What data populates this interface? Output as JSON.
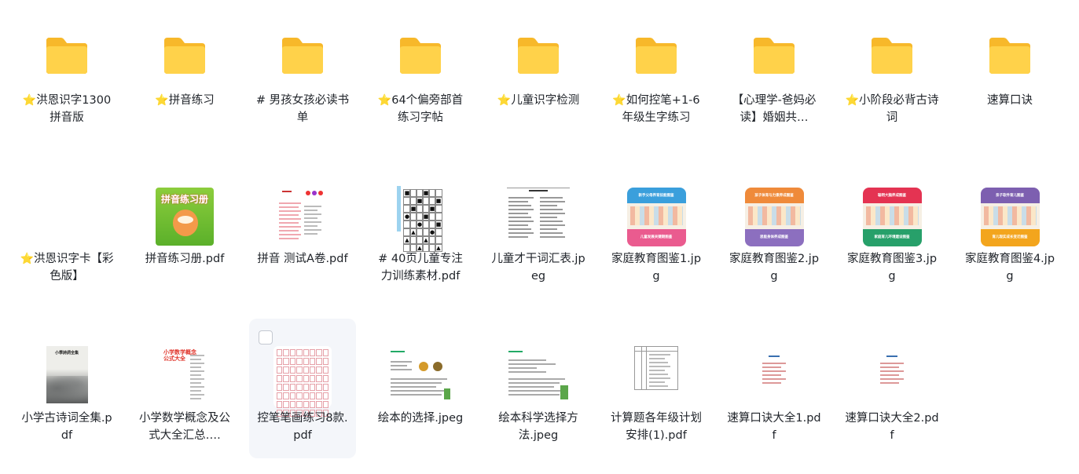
{
  "items": [
    {
      "name": "洪恩识字1300拼音版",
      "starred": true,
      "type": "folder"
    },
    {
      "name": "拼音练习",
      "starred": true,
      "type": "folder"
    },
    {
      "name": "# 男孩女孩必读书单",
      "starred": false,
      "type": "folder"
    },
    {
      "name": "64个偏旁部首练习字帖",
      "starred": true,
      "type": "folder"
    },
    {
      "name": "儿童识字检测",
      "starred": true,
      "type": "folder"
    },
    {
      "name": "如何控笔+1-6年级生字练习",
      "starred": true,
      "type": "folder"
    },
    {
      "name": "【心理学-爸妈必读】婚姻共…",
      "starred": false,
      "type": "folder"
    },
    {
      "name": "小阶段必背古诗词",
      "starred": true,
      "type": "folder"
    },
    {
      "name": "速算口诀",
      "starred": false,
      "type": "folder"
    },
    {
      "name": "洪恩识字卡【彩色版】",
      "starred": true,
      "type": "folder"
    },
    {
      "name": "拼音练习册.pdf",
      "starred": false,
      "type": "pinyin-cover"
    },
    {
      "name": "拼音 测试A卷.pdf",
      "starred": false,
      "type": "doc-thumb"
    },
    {
      "name": "# 40页儿童专注力训练素材.pdf",
      "starred": false,
      "type": "grid-thumb"
    },
    {
      "name": "儿童才干词汇表.jpeg",
      "starred": false,
      "type": "table-thumb"
    },
    {
      "name": "家庭教育图鉴1.jpg",
      "starred": false,
      "type": "card1"
    },
    {
      "name": "家庭教育图鉴2.jpg",
      "starred": false,
      "type": "card2"
    },
    {
      "name": "家庭教育图鉴3.jpg",
      "starred": false,
      "type": "card3"
    },
    {
      "name": "家庭教育图鉴4.jpg",
      "starred": false,
      "type": "card4"
    },
    {
      "name": "小学古诗词全集.pdf",
      "starred": false,
      "type": "poem-cover"
    },
    {
      "name": "小学数学概念及公式大全汇总….",
      "starred": false,
      "type": "math-cover"
    },
    {
      "name": "控笔笔画练习8款.pdf",
      "starred": false,
      "type": "stroke-thumb"
    },
    {
      "name": "绘本的选择.jpeg",
      "starred": false,
      "type": "book-thumb"
    },
    {
      "name": "绘本科学选择方法.jpeg",
      "starred": false,
      "type": "book-thumb2"
    },
    {
      "name": "计算题各年级计划安排(1).pdf",
      "starred": false,
      "type": "plan-thumb"
    },
    {
      "name": "速算口诀大全1.pdf",
      "starred": false,
      "type": "mini-thumb"
    },
    {
      "name": "速算口诀大全2.pdf",
      "starred": false,
      "type": "mini-thumb"
    }
  ],
  "cards": {
    "card1": {
      "top": "新手父母养育技能图鉴",
      "bottom": "儿童发展关键期图鉴",
      "c1": "#3a9fdc",
      "c2": "#ea5b8f"
    },
    "card2": {
      "top": "孩子体育与力素养成图鉴",
      "bottom": "思能身体养成图鉴",
      "c1": "#ef8a3a",
      "c2": "#8c6fbf"
    },
    "card3": {
      "top": "聪明大脑养成图鉴",
      "bottom": "家庭育儿环境建设图鉴",
      "c1": "#e43352",
      "c2": "#27a06a"
    },
    "card4": {
      "top": "亲子软件育儿图鉴",
      "bottom": "育儿现实成长变迁图鉴",
      "c1": "#7d5fb0",
      "c2": "#f3a51d"
    }
  },
  "thumb_text": {
    "pinyin_title": "拼音练习册",
    "poem_title": "小學詩詞全集",
    "math_title": "小学数学概念公式大全"
  },
  "colors": {
    "folder_back": "#f7b82a",
    "folder_front": "#ffd24a",
    "star": "#f7b82a",
    "hover": "#f4f6fa"
  }
}
